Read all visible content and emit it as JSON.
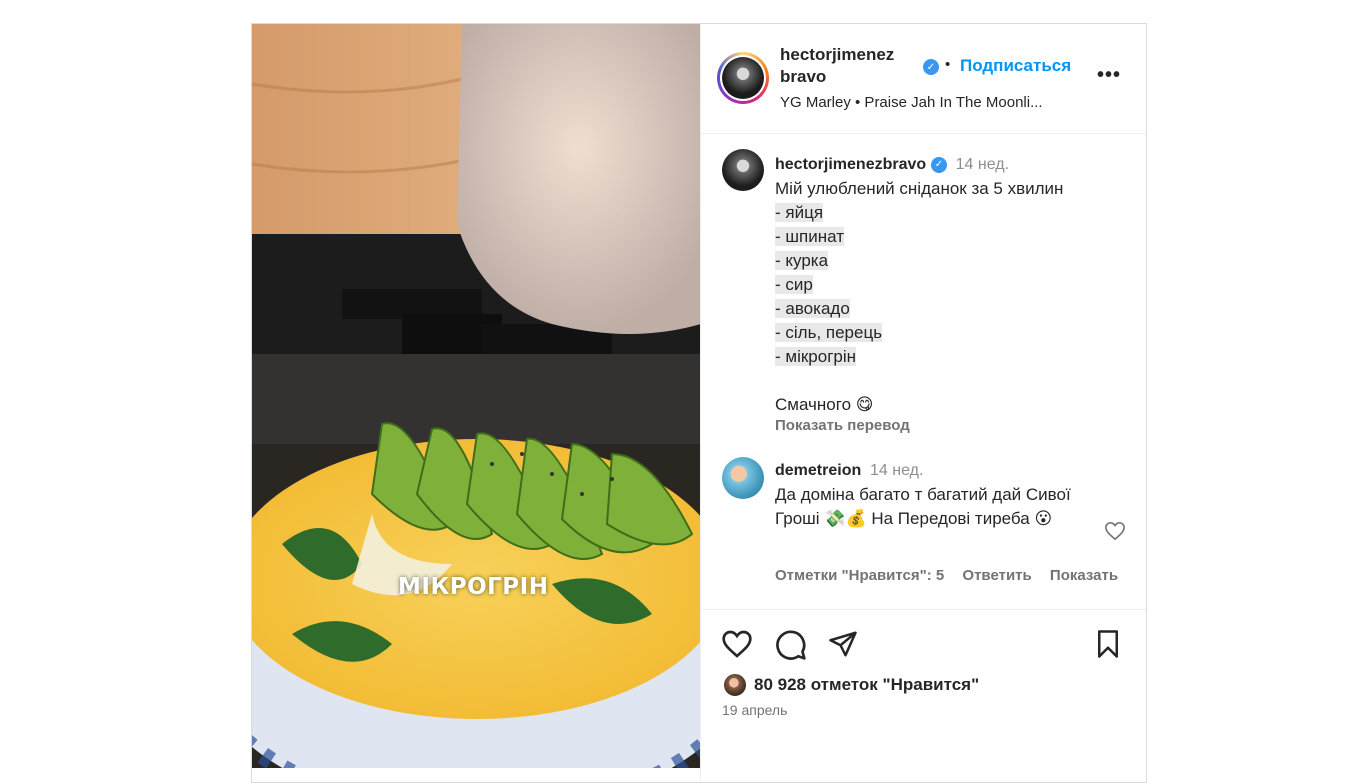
{
  "post": {
    "media_overlay_text": "МІКРОГРІН",
    "header": {
      "username_line1": "hectorjimenez",
      "username_line2": "bravo",
      "separator": "•",
      "follow_label": "Подписаться",
      "more_label": "•••",
      "music": "YG Marley • Praise Jah In The Moonli..."
    },
    "caption": {
      "username": "hectorjimenezbravo",
      "time": "14 нед.",
      "first_line": "Мій улюблений сніданок за 5 хвилин",
      "list": [
        "- яйця",
        "- шпинат",
        "- курка",
        "- сир",
        "- авокадо",
        "- сіль, перець",
        "- мікрогрін"
      ],
      "closing": "Смачного 😋",
      "translate_label": "Показать перевод"
    },
    "comment": {
      "username": "demetreion",
      "time": "14 нед.",
      "text": "Да доміна багато т багатий дай Сивої Гроші 💸💰 На Передові тиреба 😮",
      "likes_label": "Отметки \"Нравится\": 5",
      "reply_label": "Ответить",
      "show_label": "Показать"
    },
    "likes_text": "80 928 отметок \"Нравится\"",
    "date": "19 апрель"
  },
  "icons": {
    "verified": "verified-badge-icon",
    "heart": "heart-icon",
    "comment": "comment-icon",
    "share": "send-icon",
    "save": "bookmark-icon"
  },
  "colors": {
    "follow": "#0095f6",
    "verified": "#3897f0",
    "muted": "#737373"
  }
}
